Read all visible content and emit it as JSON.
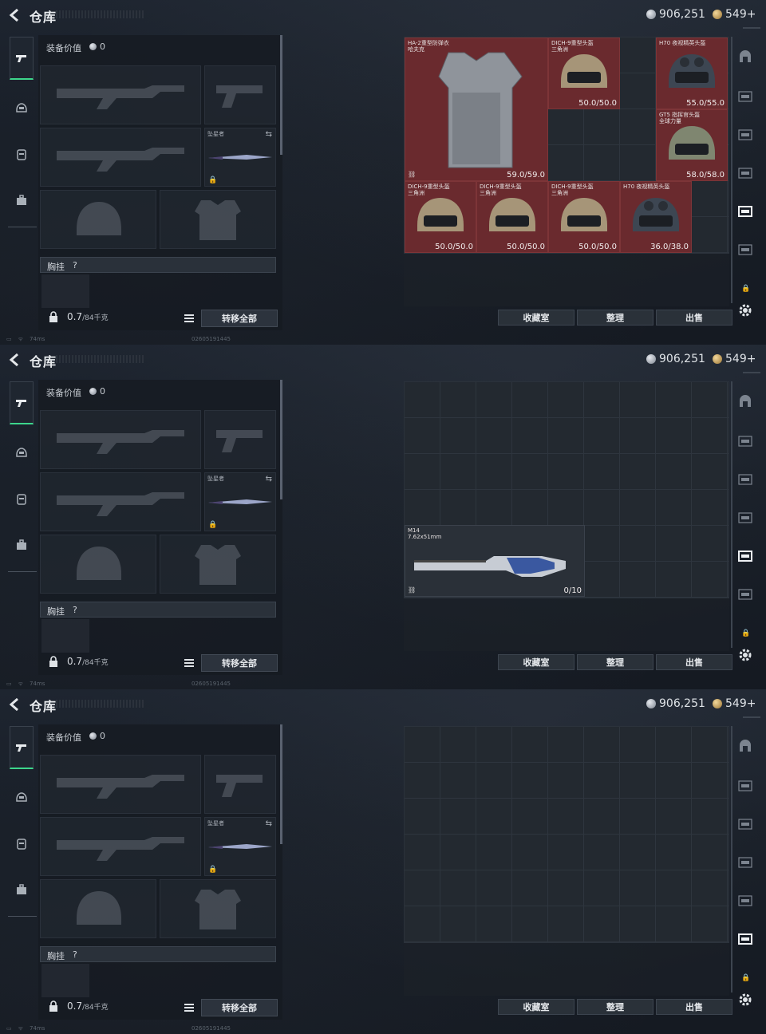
{
  "header": {
    "title": "仓库",
    "silver": "906,251",
    "gold": "549+"
  },
  "loadout": {
    "label": "装备价值",
    "value": "0",
    "melee_name": "坠星者",
    "rig_label": "胸挂",
    "rig_help": "?",
    "weight": "0.7",
    "weight_max": "/84千克",
    "transfer_all": "转移全部"
  },
  "buttons": {
    "collection": "收藏室",
    "sort": "整理",
    "sell": "出售"
  },
  "status": {
    "latency": "74ms",
    "id": "02605191445"
  },
  "panels": [
    {
      "items": [
        {
          "name": "HA-2重型防弹衣\n哈夫克",
          "dur": "59.0/59.0",
          "kind": "armor"
        },
        {
          "name": "DICH-9重型头盔\n三角洲",
          "dur": "50.0/50.0",
          "kind": "helmet"
        },
        {
          "name": "H70 夜视精英头盔",
          "dur": "55.0/55.0",
          "kind": "nv"
        },
        {
          "name": "GT5 指挥官头盔\n全球力量",
          "dur": "58.0/58.0",
          "kind": "gt5"
        },
        {
          "name": "DICH-9重型头盔\n三角洲",
          "dur": "50.0/50.0",
          "kind": "helmet"
        },
        {
          "name": "DICH-9重型头盔\n三角洲",
          "dur": "50.0/50.0",
          "kind": "helmet"
        },
        {
          "name": "DICH-9重型头盔\n三角洲",
          "dur": "50.0/50.0",
          "kind": "helmet"
        },
        {
          "name": "H70 夜视精英头盔",
          "dur": "36.0/38.0",
          "kind": "nv"
        }
      ]
    },
    {
      "items": [
        {
          "name": "M14\n7.62x51mm",
          "dur": "0/10",
          "kind": "rifle"
        }
      ]
    },
    {
      "items": []
    }
  ],
  "icons": {
    "back": "back-arrow-icon",
    "tabs_left": [
      "gun-icon",
      "helmet-icon",
      "backpack-icon",
      "briefcase-icon"
    ],
    "tabs_right": [
      "arch-icon",
      "stash-page-icon",
      "stash-page-icon",
      "stash-page-icon",
      "stash-page-icon",
      "stash-page-icon"
    ],
    "gear": "gear-icon",
    "lock": "lock-icon"
  },
  "colors": {
    "accent": "#3dd68c",
    "item_bg": "#6a2a2e"
  }
}
